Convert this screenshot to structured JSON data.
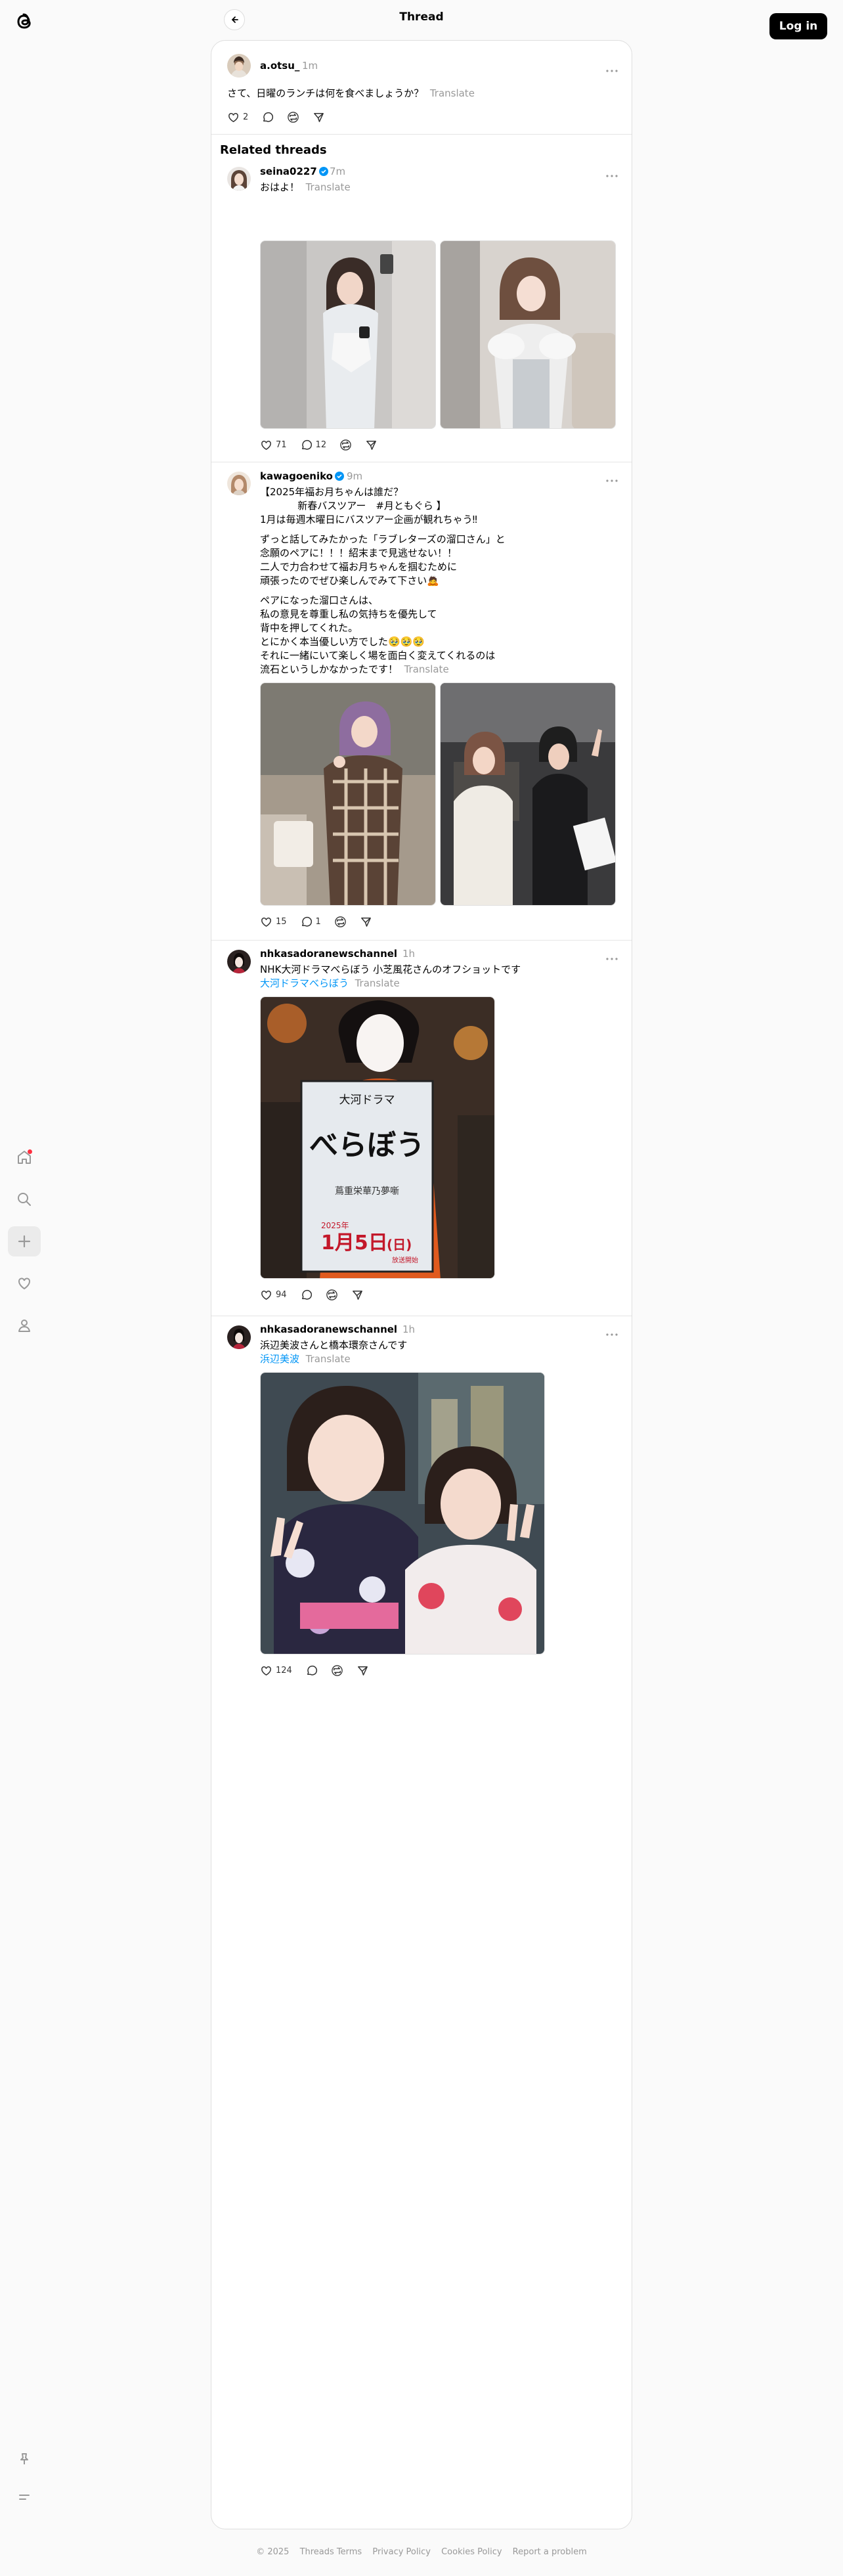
{
  "header": {
    "title": "Thread",
    "login_label": "Log in"
  },
  "main_post": {
    "username": "a.otsu_",
    "time": "1m",
    "text": "さて、日曜のランチは何を食べましょうか？",
    "translate": "Translate",
    "likes": "2"
  },
  "related_title": "Related threads",
  "posts": [
    {
      "username": "seina0227",
      "time": "7m",
      "text": "おはよ！",
      "translate": "Translate",
      "likes": "71",
      "replies": "12"
    },
    {
      "username": "kawagoeniko",
      "time": "9m",
      "lines": [
        "【2025年福お月ちゃんは誰だ？",
        "            新春バスツアー　#月ともぐら 】",
        "1月は毎週木曜日にバスツアー企画が観れちゃう‼︎",
        "ずっと話してみたかった「ラブレターズの溜口さん」と",
        "念願のペアに！！！紹末まで見逃せない！！",
        "二人で力合わせて福お月ちゃんを掴むために",
        "頑張ったのでぜひ楽しんでみて下さい🙇",
        "ペアになった溜口さんは、",
        "私の意見を尊重し私の気持ちを優先して",
        "背中を押してくれた。",
        "とにかく本当優しい方でした🥹🥹🥹",
        "それに一緒にいて楽しく場を面白く変えてくれるのは",
        "流石というしかなかったです！"
      ],
      "translate": "Translate",
      "likes": "15",
      "replies": "1"
    },
    {
      "username": "nhkasadoranewschannel",
      "time": "1h",
      "text": "NHK大河ドラマべらぼう 小芝風花さんのオフショットです",
      "hashtag": "大河ドラマべらぼう",
      "translate": "Translate",
      "likes": "94"
    },
    {
      "username": "nhkasadoranewschannel",
      "time": "1h",
      "text": "浜辺美波さんと橋本環奈さんです",
      "hashtag": "浜辺美波",
      "translate": "Translate",
      "likes": "124"
    }
  ],
  "sign": {
    "brand": "大河ドラマ",
    "title": "べらぼう",
    "sub": "蔦重栄華乃夢噺",
    "date_prefix": "2025年",
    "date_main": "1月5日",
    "date_day": "(日)",
    "date_suffix": "放送開始"
  },
  "footer": [
    "© 2025",
    "Threads Terms",
    "Privacy Policy",
    "Cookies Policy",
    "Report a problem"
  ],
  "colors": {
    "accent": "#0095f6",
    "verified": "#0095f6",
    "notification": "#ff3040"
  }
}
